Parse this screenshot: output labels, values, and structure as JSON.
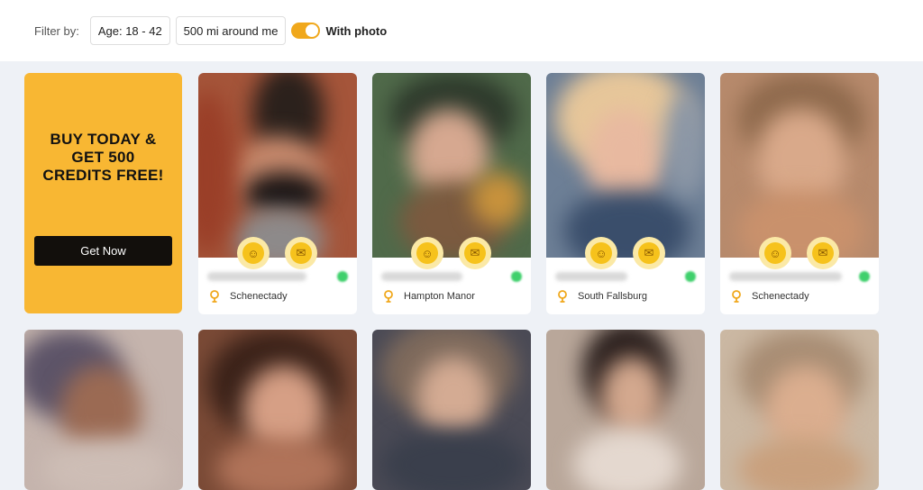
{
  "filter": {
    "label": "Filter by:",
    "age": "Age: 18 - 42",
    "distance": "500 mi around me",
    "with_photo_label": "With photo",
    "with_photo_on": true
  },
  "promo": {
    "title": "BUY TODAY & GET 500 CREDITS FREE!",
    "button": "Get Now"
  },
  "colors": {
    "accent": "#f8b733",
    "toggle": "#f0a81c",
    "online": "#3fd06c"
  },
  "profiles_row1": [
    {
      "location": "Schenectady",
      "online": true
    },
    {
      "location": "Hampton Manor",
      "online": true
    },
    {
      "location": "South Fallsburg",
      "online": true
    },
    {
      "location": "Schenectady",
      "online": true
    }
  ],
  "profiles_row2_count": 5
}
